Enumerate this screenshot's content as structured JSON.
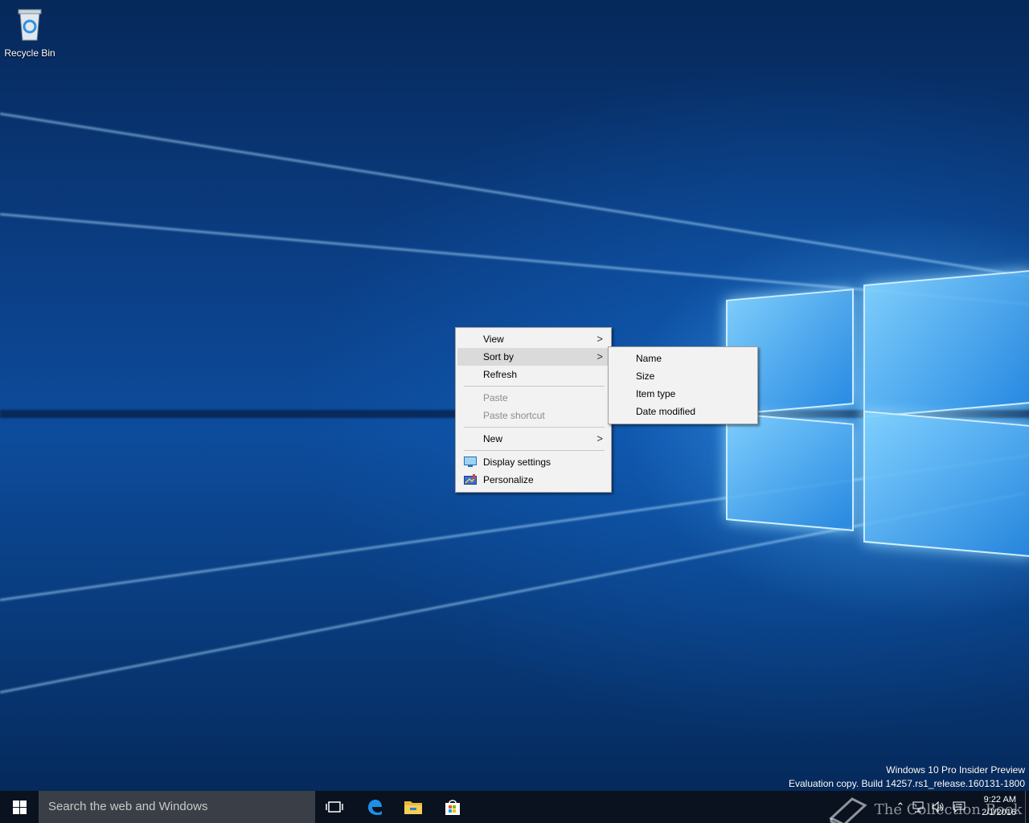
{
  "desktop": {
    "icons": [
      {
        "label": "Recycle Bin",
        "icon": "recycle-bin-icon"
      }
    ]
  },
  "context_menu": {
    "items": [
      {
        "label": "View",
        "has_submenu": true
      },
      {
        "label": "Sort by",
        "has_submenu": true,
        "highlighted": true
      },
      {
        "label": "Refresh"
      },
      {
        "label": "Paste",
        "disabled": true
      },
      {
        "label": "Paste shortcut",
        "disabled": true
      },
      {
        "label": "New",
        "has_submenu": true
      },
      {
        "label": "Display settings",
        "icon": "display-icon"
      },
      {
        "label": "Personalize",
        "icon": "personalize-icon"
      }
    ],
    "arrow_glyph": ">"
  },
  "sort_submenu": {
    "items": [
      {
        "label": "Name"
      },
      {
        "label": "Size"
      },
      {
        "label": "Item type"
      },
      {
        "label": "Date modified"
      }
    ]
  },
  "watermark": {
    "line1": "Windows 10 Pro Insider Preview",
    "line2": "Evaluation copy. Build 14257.rs1_release.160131-1800"
  },
  "taskbar": {
    "search_placeholder": "Search the web and Windows",
    "pinned": [
      "task-view-icon",
      "edge-icon",
      "file-explorer-icon",
      "store-icon"
    ],
    "tray_icons": [
      "chevron-up-icon",
      "network-icon",
      "volume-icon",
      "action-center-icon"
    ],
    "time": "9:22 AM",
    "date": "2/1/2016"
  },
  "brand_overlay": "The Collection Book",
  "colors": {
    "taskbar": "#0a1220",
    "menu_bg": "#f2f2f2",
    "highlight": "#dadada",
    "accent": "#0078d7"
  }
}
